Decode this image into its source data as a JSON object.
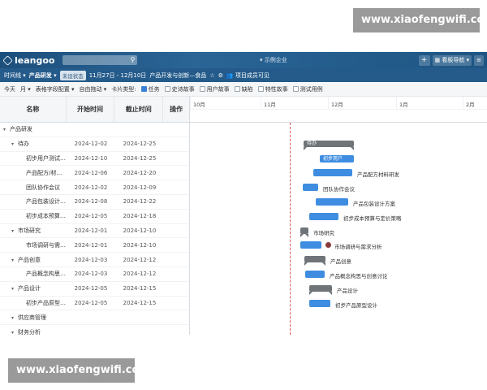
{
  "watermark": "www.xiaofengwifi.com",
  "header": {
    "logo": "leangoo",
    "center_title": "示例企业",
    "board_nav": "看板导航"
  },
  "subbar": {
    "view": "时间线",
    "project": "产品研发",
    "status": "未设状态",
    "date_range": "11月27日 - 12月10日",
    "board_path": "产品开发与创新—食品",
    "members": "项目成员可见"
  },
  "toolbar": {
    "today": "今天",
    "scale": "月",
    "fields": "表格字段配置",
    "drag": "自由拖动",
    "card_type": "卡片类型:",
    "filters": [
      {
        "label": "任务",
        "checked": true
      },
      {
        "label": "史诗故事",
        "checked": false
      },
      {
        "label": "用户故事",
        "checked": false
      },
      {
        "label": "缺陷",
        "checked": false
      },
      {
        "label": "特性故事",
        "checked": false
      },
      {
        "label": "测试用例",
        "checked": false
      }
    ]
  },
  "columns": {
    "name": "名称",
    "start": "开始时间",
    "end": "截止时间",
    "op": "操作"
  },
  "timeline": {
    "months": [
      "10月",
      "11月",
      "12月",
      "1月",
      "2月"
    ]
  },
  "rows": [
    {
      "name": "产品研发",
      "level": 0,
      "caret": true,
      "start": "",
      "end": "",
      "bar": null
    },
    {
      "name": "待办",
      "level": 1,
      "caret": true,
      "start": "2024-12-02",
      "end": "2024-12-25",
      "bar": {
        "kind": "group",
        "text": "待办"
      }
    },
    {
      "name": "初步用户测试与...",
      "level": 2,
      "caret": false,
      "start": "2024-12-10",
      "end": "2024-12-25",
      "bar": {
        "kind": "task",
        "text": "初步用户"
      }
    },
    {
      "name": "产品配方/材料研发",
      "level": 2,
      "caret": false,
      "start": "2024-12-06",
      "end": "2024-12-20",
      "bar": {
        "kind": "task",
        "label": "产品配方材料研发"
      }
    },
    {
      "name": "团队协作会议",
      "level": 2,
      "caret": false,
      "start": "2024-12-02",
      "end": "2024-12-09",
      "bar": {
        "kind": "task",
        "label": "团队协作会议"
      }
    },
    {
      "name": "产品包装设计方案",
      "level": 2,
      "caret": false,
      "start": "2024-12-08",
      "end": "2024-12-22",
      "bar": {
        "kind": "task",
        "label": "产品包装设计方案"
      }
    },
    {
      "name": "初步成本预算与...",
      "level": 2,
      "caret": false,
      "start": "2024-12-05",
      "end": "2024-12-18",
      "bar": {
        "kind": "task",
        "label": "初步成本预算与定价策略"
      }
    },
    {
      "name": "市场研究",
      "level": 1,
      "caret": true,
      "start": "2024-12-01",
      "end": "2024-12-10",
      "bar": {
        "kind": "group",
        "label": "市场研究"
      }
    },
    {
      "name": "市场调研与需求...",
      "level": 2,
      "caret": false,
      "start": "2024-12-01",
      "end": "2024-12-10",
      "bar": {
        "kind": "task",
        "label": "市场调研与需求分析"
      }
    },
    {
      "name": "产品创意",
      "level": 1,
      "caret": true,
      "start": "2024-12-03",
      "end": "2024-12-12",
      "bar": {
        "kind": "group",
        "label": "产品创意"
      }
    },
    {
      "name": "产品概念构思与...",
      "level": 2,
      "caret": false,
      "start": "2024-12-03",
      "end": "2024-12-12",
      "bar": {
        "kind": "task",
        "label": "产品概念构思与创意讨论"
      }
    },
    {
      "name": "产品设计",
      "level": 1,
      "caret": true,
      "start": "2024-12-05",
      "end": "2024-12-15",
      "bar": {
        "kind": "group",
        "label": "产品设计"
      }
    },
    {
      "name": "初步产品原型设计",
      "level": 2,
      "caret": false,
      "start": "2024-12-05",
      "end": "2024-12-15",
      "bar": {
        "kind": "task",
        "label": "初步产品原型设计"
      }
    },
    {
      "name": "供应商管理",
      "level": 1,
      "caret": true,
      "start": "",
      "end": "",
      "bar": null
    },
    {
      "name": "财务分析",
      "level": 1,
      "caret": true,
      "start": "",
      "end": "",
      "bar": null
    }
  ]
}
